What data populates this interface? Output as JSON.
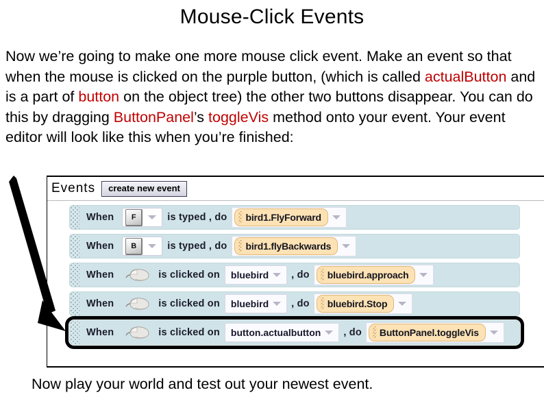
{
  "slide": {
    "title": "Mouse-Click Events",
    "body_segments": [
      {
        "text": "Now we’re going to make one more mouse click event. Make an event so that when the mouse is clicked on the purple button, (which is called ",
        "highlight": false
      },
      {
        "text": "actualButton",
        "highlight": true
      },
      {
        "text": " and is a part of ",
        "highlight": false
      },
      {
        "text": "button",
        "highlight": true
      },
      {
        "text": " on the object tree) the other two buttons disappear. You can do this by dragging ",
        "highlight": false
      },
      {
        "text": "ButtonPanel",
        "highlight": true
      },
      {
        "text": "’s ",
        "highlight": false
      },
      {
        "text": "toggleVis",
        "highlight": true
      },
      {
        "text": " method onto your event. Your event editor will look like this when you’re finished:",
        "highlight": false
      }
    ],
    "bottom_text": "Now play your world and test out your newest event.",
    "highlight_color": "#c00000",
    "text_color": "#000000"
  },
  "events_panel": {
    "label": "Events",
    "create_button": "create new event",
    "row_background": "#cfe3e8",
    "method_tile_color": "#fce2b4",
    "rows": [
      {
        "when": "When",
        "trigger_type": "key",
        "key": "F",
        "predicate": "is typed , do",
        "target": null,
        "comma": null,
        "method": "bird1.FlyForward",
        "highlighted": false
      },
      {
        "when": "When",
        "trigger_type": "key",
        "key": "B",
        "predicate": "is typed , do",
        "target": null,
        "comma": null,
        "method": "bird1.flyBackwards",
        "highlighted": false
      },
      {
        "when": "When",
        "trigger_type": "mouse",
        "key": null,
        "predicate": "is clicked on",
        "target": "bluebird",
        "comma": ", do",
        "method": "bluebird.approach",
        "highlighted": false
      },
      {
        "when": "When",
        "trigger_type": "mouse",
        "key": null,
        "predicate": "is clicked on",
        "target": "bluebird",
        "comma": ", do",
        "method": "bluebird.Stop",
        "highlighted": false
      },
      {
        "when": "When",
        "trigger_type": "mouse",
        "key": null,
        "predicate": "is clicked on",
        "target": "button.actualbutton",
        "comma": ", do",
        "method": "ButtonPanel.toggleVis",
        "highlighted": true
      }
    ]
  }
}
